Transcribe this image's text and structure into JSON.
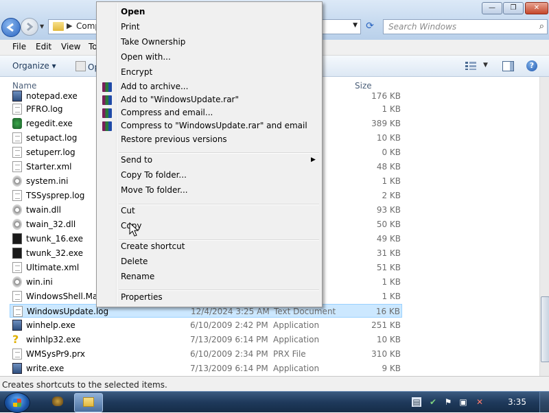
{
  "window": {
    "address_path": "Comp",
    "search_placeholder": "Search Windows",
    "controls": {
      "minimize": "—",
      "maximize": "❐",
      "close": "✕"
    }
  },
  "menubar": {
    "items": [
      "File",
      "Edit",
      "View",
      "To"
    ]
  },
  "toolbar": {
    "organize": "Organize ▾",
    "open": "Op"
  },
  "columns": {
    "name": "Name",
    "size": "Size"
  },
  "files": [
    {
      "name": "notepad.exe",
      "date": "",
      "type": "",
      "size": "176 KB",
      "icon": "exe"
    },
    {
      "name": "PFRO.log",
      "date": "",
      "type": "nt",
      "size": "1 KB",
      "icon": "doc"
    },
    {
      "name": "regedit.exe",
      "date": "",
      "type": "",
      "size": "389 KB",
      "icon": "reg"
    },
    {
      "name": "setupact.log",
      "date": "",
      "type": "nt",
      "size": "10 KB",
      "icon": "doc"
    },
    {
      "name": "setuperr.log",
      "date": "",
      "type": "nt",
      "size": "0 KB",
      "icon": "doc"
    },
    {
      "name": "Starter.xml",
      "date": "",
      "type": "nt",
      "size": "48 KB",
      "icon": "doc"
    },
    {
      "name": "system.ini",
      "date": "",
      "type": "n sett...",
      "size": "1 KB",
      "icon": "gear"
    },
    {
      "name": "TSSysprep.log",
      "date": "",
      "type": "nt",
      "size": "2 KB",
      "icon": "doc"
    },
    {
      "name": "twain.dll",
      "date": "",
      "type": "xtens...",
      "size": "93 KB",
      "icon": "gear"
    },
    {
      "name": "twain_32.dll",
      "date": "",
      "type": "xtens...",
      "size": "50 KB",
      "icon": "gear"
    },
    {
      "name": "twunk_16.exe",
      "date": "",
      "type": "",
      "size": "49 KB",
      "icon": "twunk"
    },
    {
      "name": "twunk_32.exe",
      "date": "",
      "type": "",
      "size": "31 KB",
      "icon": "twunk"
    },
    {
      "name": "Ultimate.xml",
      "date": "",
      "type": "nt",
      "size": "51 KB",
      "icon": "doc"
    },
    {
      "name": "win.ini",
      "date": "",
      "type": "n sett...",
      "size": "1 KB",
      "icon": "gear"
    },
    {
      "name": "WindowsShell.Man",
      "date": "",
      "type": "e",
      "size": "1 KB",
      "icon": "doc"
    },
    {
      "name": "WindowsUpdate.log",
      "date": "12/4/2024 3:25 AM",
      "type": "Text Document",
      "size": "16 KB",
      "icon": "doc",
      "selected": true
    },
    {
      "name": "winhelp.exe",
      "date": "6/10/2009 2:42 PM",
      "type": "Application",
      "size": "251 KB",
      "icon": "exe"
    },
    {
      "name": "winhlp32.exe",
      "date": "7/13/2009 6:14 PM",
      "type": "Application",
      "size": "10 KB",
      "icon": "help"
    },
    {
      "name": "WMSysPr9.prx",
      "date": "6/10/2009 2:34 PM",
      "type": "PRX File",
      "size": "310 KB",
      "icon": "doc"
    },
    {
      "name": "write.exe",
      "date": "7/13/2009 6:14 PM",
      "type": "Application",
      "size": "9 KB",
      "icon": "exe"
    }
  ],
  "context_menu": [
    {
      "label": "Open",
      "bold": true
    },
    {
      "label": "Print"
    },
    {
      "label": "Take Ownership"
    },
    {
      "label": "Open with..."
    },
    {
      "label": "Encrypt"
    },
    {
      "label": "Add to archive...",
      "icon": "winrar-icon"
    },
    {
      "label": "Add to \"WindowsUpdate.rar\"",
      "icon": "winrar-icon"
    },
    {
      "label": "Compress and email...",
      "icon": "winrar-icon"
    },
    {
      "label": "Compress to \"WindowsUpdate.rar\" and email",
      "icon": "winrar-icon"
    },
    {
      "label": "Restore previous versions"
    },
    {
      "separator": true
    },
    {
      "label": "Send to",
      "submenu": true
    },
    {
      "label": "Copy To folder..."
    },
    {
      "label": "Move To folder..."
    },
    {
      "separator": true
    },
    {
      "label": "Cut"
    },
    {
      "label": "Copy"
    },
    {
      "separator": true
    },
    {
      "label": "Create shortcut"
    },
    {
      "label": "Delete"
    },
    {
      "label": "Rename"
    },
    {
      "separator": true
    },
    {
      "label": "Properties"
    }
  ],
  "status": {
    "text": "Creates shortcuts to the selected items."
  },
  "taskbar": {
    "clock": "3:35"
  }
}
